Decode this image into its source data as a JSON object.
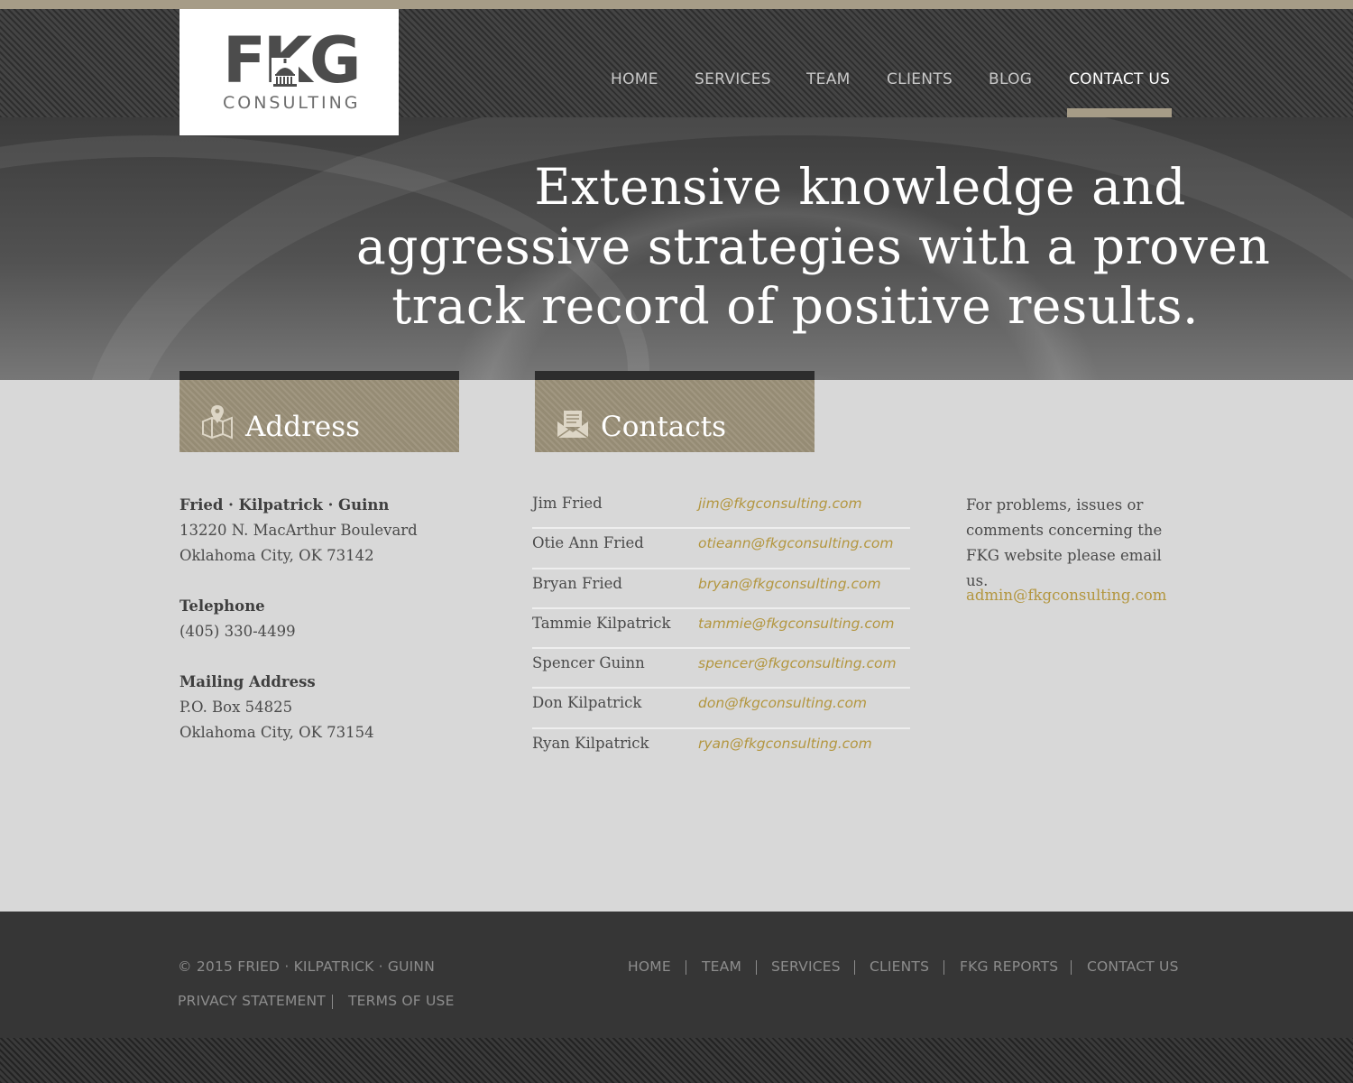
{
  "brand": {
    "logo_main": "FKG",
    "logo_sub": "CONSULTING"
  },
  "colors": {
    "accent": "#a69c87",
    "link": "#b3963f",
    "footer_bg": "#363636",
    "content_bg": "#d8d8d8"
  },
  "nav": {
    "items": [
      {
        "label": "HOME"
      },
      {
        "label": "SERVICES"
      },
      {
        "label": "TEAM"
      },
      {
        "label": "CLIENTS"
      },
      {
        "label": "BLOG"
      },
      {
        "label": "CONTACT US"
      }
    ],
    "active": "CONTACT US"
  },
  "hero": {
    "line1": "Extensive knowledge and",
    "line2": "aggressive strategies with a proven",
    "line3": "track record of positive results."
  },
  "address_section": {
    "title": "Address",
    "icon": "map-pin-icon",
    "company": "Fried · Kilpatrick · Guinn",
    "street": "13220 N. MacArthur Boulevard",
    "city": "Oklahoma City, OK 73142",
    "telephone_label": "Telephone",
    "telephone": "(405) 330-4499",
    "mailing_label": "Mailing Address",
    "po_box": "P.O. Box 54825",
    "mailing_city": "Oklahoma City, OK 73154"
  },
  "contacts_section": {
    "title": "Contacts",
    "icon": "envelope-icon",
    "people": [
      {
        "name": "Jim Fried",
        "email": "jim@fkgconsulting.com"
      },
      {
        "name": "Otie Ann Fried",
        "email": "otieann@fkgconsulting.com"
      },
      {
        "name": "Bryan Fried",
        "email": "bryan@fkgconsulting.com"
      },
      {
        "name": "Tammie Kilpatrick",
        "email": "tammie@fkgconsulting.com"
      },
      {
        "name": "Spencer Guinn",
        "email": "spencer@fkgconsulting.com"
      },
      {
        "name": "Don Kilpatrick",
        "email": "don@fkgconsulting.com"
      },
      {
        "name": "Ryan Kilpatrick",
        "email": "ryan@fkgconsulting.com"
      }
    ]
  },
  "support": {
    "text": "For problems, issues or comments concerning the FKG website please email us.",
    "email": "admin@fkgconsulting.com"
  },
  "footer": {
    "copyright": "© 2015  FRIED · KILPATRICK · GUINN",
    "privacy": "PRIVACY STATEMENT",
    "terms": "TERMS OF USE",
    "links": [
      {
        "label": "HOME"
      },
      {
        "label": "TEAM"
      },
      {
        "label": "SERVICES"
      },
      {
        "label": "CLIENTS"
      },
      {
        "label": "FKG REPORTS"
      },
      {
        "label": "CONTACT US"
      }
    ]
  }
}
